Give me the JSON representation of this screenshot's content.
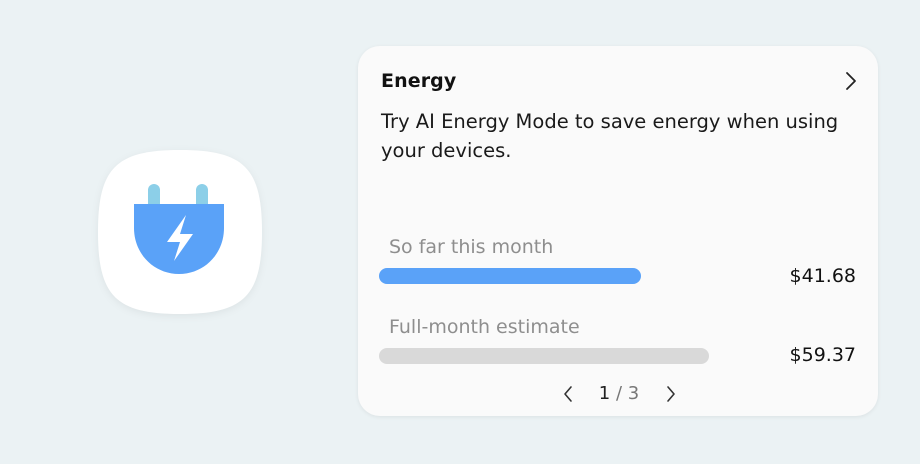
{
  "app_icon": {
    "icon": "plug-icon",
    "accent_color": "#5aa2f8",
    "prong_color": "#8ccfe8"
  },
  "card": {
    "title": "Energy",
    "description": "Try AI Energy Mode to save energy when using your devices.",
    "stats": [
      {
        "label": "So far this month",
        "amount": "$41.68",
        "bar_color": "#5aa2f8"
      },
      {
        "label": "Full-month estimate",
        "amount": "$59.37",
        "bar_color": "#d9d9d9"
      }
    ],
    "pager": {
      "current": "1",
      "separator": " / ",
      "total": "3"
    }
  }
}
